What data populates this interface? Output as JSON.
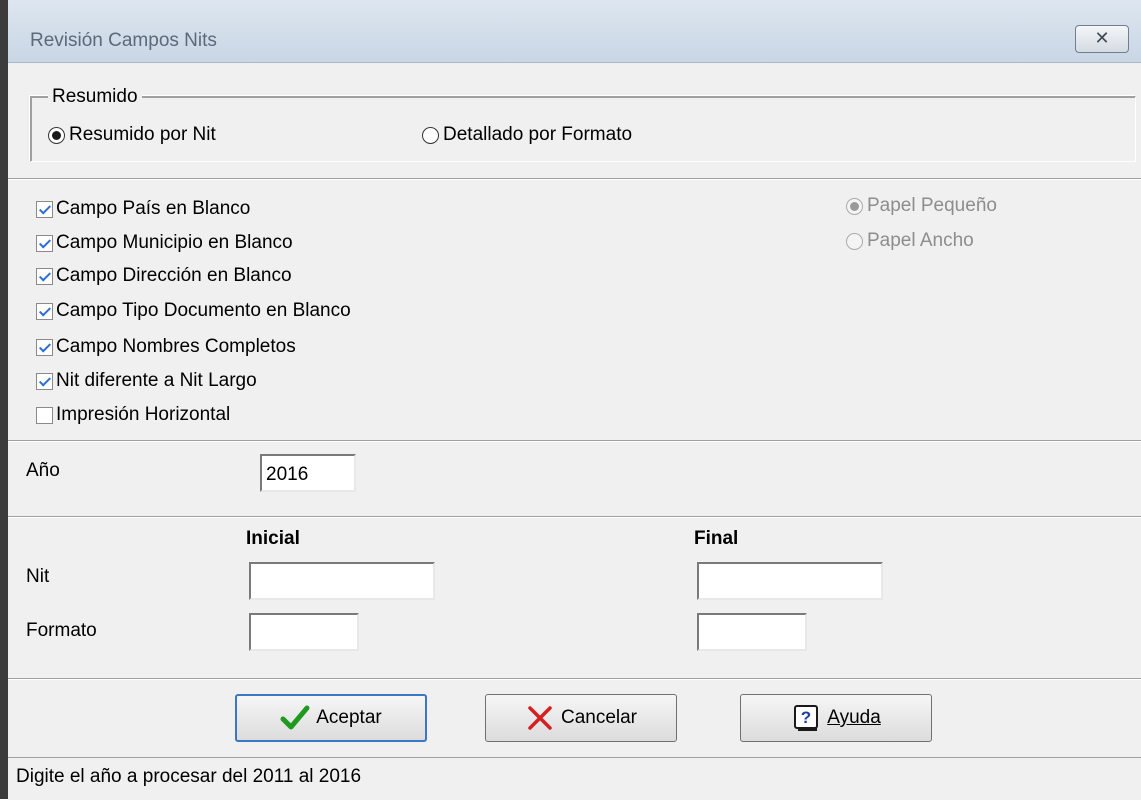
{
  "window": {
    "title": "Revisión Campos Nits",
    "close_icon": "close-icon"
  },
  "resumido": {
    "group_title": "Resumido",
    "options": [
      {
        "label": "Resumido por Nit",
        "selected": true
      },
      {
        "label": "Detallado por Formato",
        "selected": false
      }
    ]
  },
  "checks": [
    {
      "label": "Campo País en Blanco",
      "checked": true
    },
    {
      "label": "Campo Municipio en Blanco",
      "checked": true
    },
    {
      "label": "Campo Dirección en Blanco",
      "checked": true
    },
    {
      "label": "Campo Tipo Documento en Blanco",
      "checked": true
    },
    {
      "label": "Campo Nombres Completos",
      "checked": true
    },
    {
      "label": "Nit diferente a Nit Largo",
      "checked": true
    },
    {
      "label": "Impresión Horizontal",
      "checked": false
    }
  ],
  "paper": {
    "options": [
      {
        "label": "Papel Pequeño",
        "selected": true,
        "enabled": false
      },
      {
        "label": "Papel Ancho",
        "selected": false,
        "enabled": false
      }
    ]
  },
  "year": {
    "label": "Año",
    "value": "2016"
  },
  "range": {
    "initial_header": "Inicial",
    "final_header": "Final",
    "nit_label": "Nit",
    "formato_label": "Formato",
    "nit_initial": "",
    "nit_final": "",
    "formato_initial": "",
    "formato_final": ""
  },
  "buttons": {
    "accept": "Aceptar",
    "cancel": "Cancelar",
    "help": "Ayuda"
  },
  "status": {
    "text": "Digite el año a procesar del 2011 al 2016"
  },
  "colors": {
    "check": "#2a6fd6",
    "accept_icon": "#1f9a1f",
    "cancel_icon": "#d42020"
  }
}
